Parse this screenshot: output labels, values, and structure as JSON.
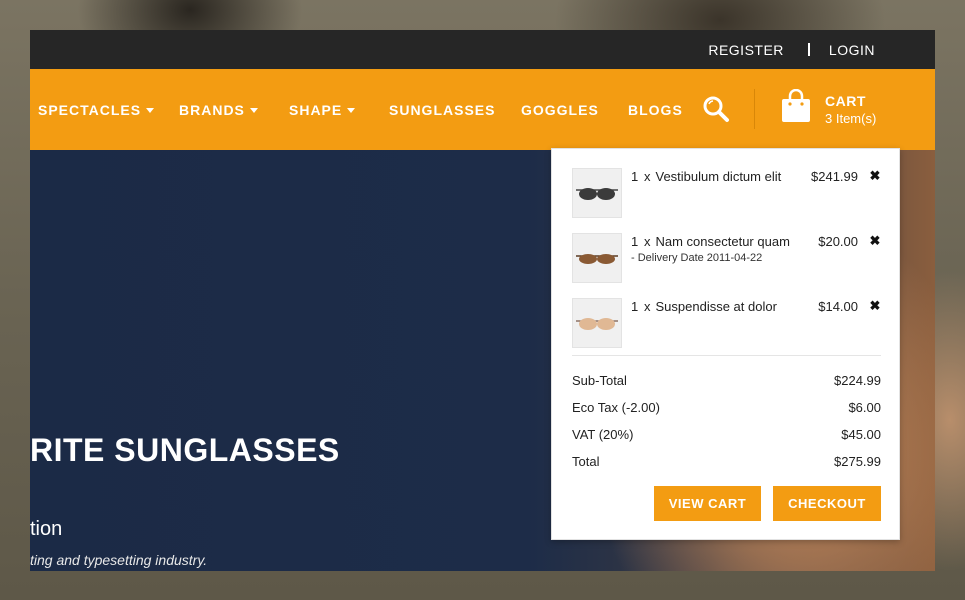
{
  "topbar": {
    "register": "REGISTER",
    "login": "LOGIN"
  },
  "nav": {
    "items": [
      {
        "label": "SPECTACLES",
        "dropdown": true
      },
      {
        "label": "BRANDS",
        "dropdown": true
      },
      {
        "label": "SHAPE",
        "dropdown": true
      },
      {
        "label": "SUNGLASSES",
        "dropdown": false
      },
      {
        "label": "GOGGLES",
        "dropdown": false
      },
      {
        "label": "BLOGS",
        "dropdown": false
      }
    ],
    "search_icon": "search-icon",
    "cart_icon": "shopping-bag-icon"
  },
  "cart": {
    "title": "CART",
    "count": "3 Item(s)",
    "products": [
      {
        "qty": "1",
        "x": "x",
        "name": "Vestibulum dictum elit",
        "option": "",
        "price": "$241.99",
        "remove": "✖"
      },
      {
        "qty": "1",
        "x": "x",
        "name": "Nam consectetur quam",
        "option": "- Delivery Date 2011-04-22",
        "price": "$20.00",
        "remove": "✖"
      },
      {
        "qty": "1",
        "x": "x",
        "name": "Suspendisse at dolor",
        "option": "",
        "price": "$14.00",
        "remove": "✖"
      }
    ],
    "totals": [
      {
        "label": "Sub-Total",
        "value": "$224.99"
      },
      {
        "label": "Eco Tax (-2.00)",
        "value": "$6.00"
      },
      {
        "label": "VAT (20%)",
        "value": "$45.00"
      },
      {
        "label": "Total",
        "value": "$275.99"
      }
    ],
    "view_cart": "VIEW CART",
    "checkout": "CHECKOUT"
  },
  "hero": {
    "title": "RITE SUNGLASSES",
    "subtitle": "tion",
    "description": "ting and typesetting industry."
  },
  "colors": {
    "accent": "#f39c12",
    "topbar": "#262626",
    "hero_bg": "#1c2a44"
  }
}
